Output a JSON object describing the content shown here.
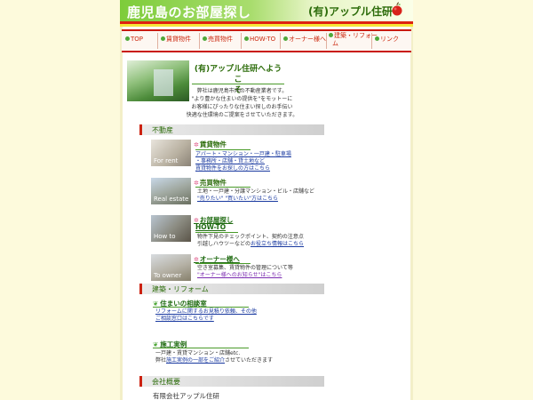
{
  "header": {
    "title": "鹿児島のお部屋探し",
    "brand": "(有)アップル住研"
  },
  "nav": {
    "items": [
      "TOP",
      "賃貸物件",
      "売買物件",
      "HOW-TO",
      "オーナー様へ",
      "建築・リフォー",
      "ム",
      "リンク"
    ]
  },
  "welcome": {
    "title_line1": "(有)アップル住研へようこ",
    "title_line2": "そ",
    "intro": [
      "弊社は鹿児島市内の不動産業者です。",
      "\"より豊かな住まいの提供を\"をモットーに",
      "お客様にぴったりな住まい探しのお手伝い",
      "快適な住環境のご提案をさせていただきます。"
    ]
  },
  "sections": {
    "realestate": "不動産",
    "reform": "建築・リフォーム",
    "company": "会社概要"
  },
  "items": {
    "rent": {
      "thumb": "For rent",
      "title": "賃貸物件",
      "line1": "アパート・マンション・一戸建・駐車場",
      "line2": "・事務所・店舗・貸土地など",
      "line3": "賃貸物件をお探しの方はこちら"
    },
    "sale": {
      "thumb": "Real estate",
      "title": "売買物件",
      "line1": "土地・一戸建・分譲マンション・ビル・店舗など",
      "line2": "\"売りたい\" \"買いたい\"方はこちら"
    },
    "howto": {
      "thumb": "How to",
      "title1": "お部屋探し",
      "title2": "HOW-TO",
      "line1": "物件下見のチェックポイント、契約の注意点",
      "line2a": "引越しハウツーなどの",
      "line2b": "お役立ち情報はこちら"
    },
    "owner": {
      "thumb": "To owner",
      "title": "オーナー様へ",
      "line1": "空き室募集、賃貸物件の管理について等",
      "line2": "\"オーナー様へのお知らせ\"はこちら"
    }
  },
  "reform": {
    "consult": {
      "title": "住まいの相談室",
      "line1": "リフォームに関するお見積り依頼、その他",
      "line2": "ご相談窓口はこちらです"
    },
    "works": {
      "title": "施工実例",
      "line1": "一戸建・賃貸マンション・店舗etc.",
      "line2a": "弊社",
      "line2b": "施工実例の一部をご紹介",
      "line2c": "させていただきます"
    }
  },
  "company": {
    "name": "有限会社アップル住研"
  },
  "colors": {
    "background": "#fdfadc",
    "header_green": "#7dcc3a",
    "accent_red": "#dd2211",
    "text_green": "#2c6c0a",
    "link_blue": "#1a3aa0"
  }
}
